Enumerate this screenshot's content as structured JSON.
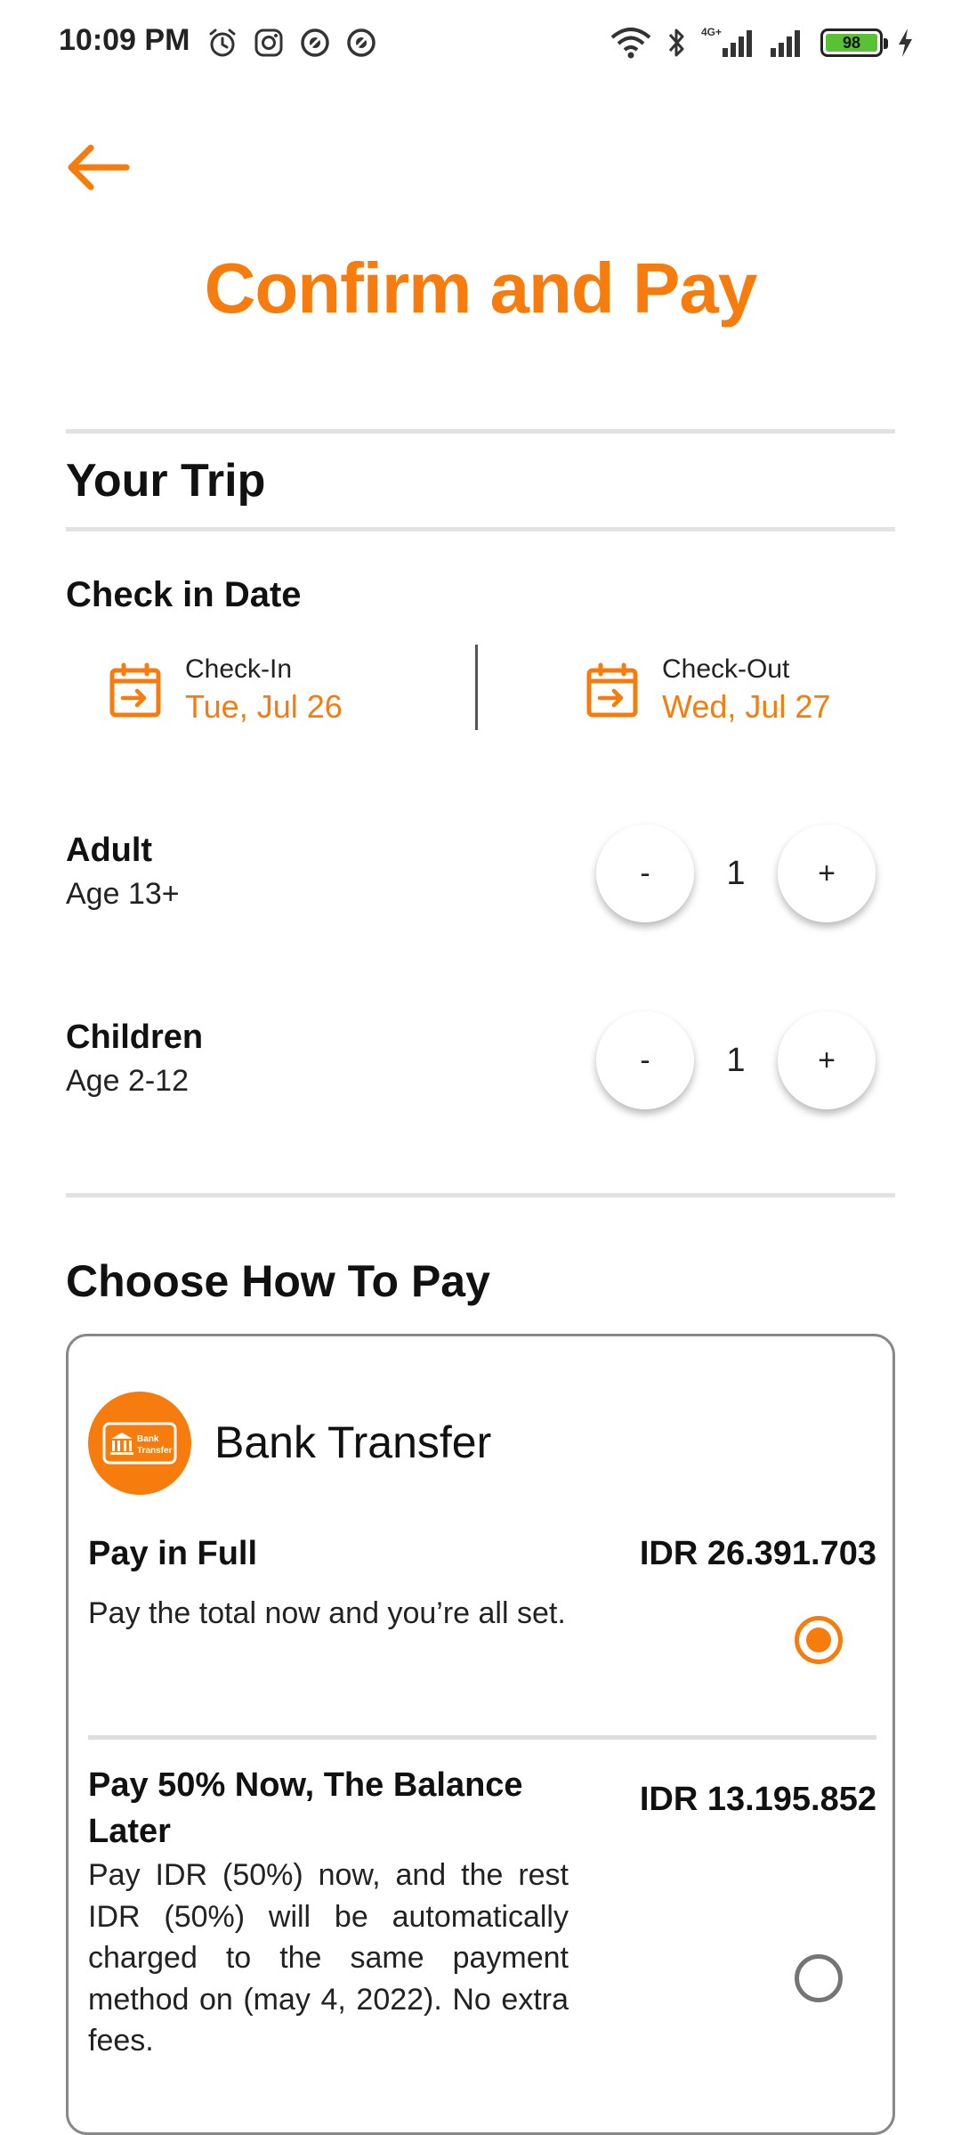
{
  "status_bar": {
    "time": "10:09 PM",
    "battery": "98",
    "left_icons": [
      "alarm-icon",
      "instagram-icon",
      "app-icon",
      "app-icon"
    ],
    "right_icons": [
      "wifi-icon",
      "bluetooth-icon",
      "signal-4g-icon",
      "signal-icon",
      "battery-icon",
      "charging-icon"
    ],
    "network_label": "4G+"
  },
  "header": {
    "title": "Confirm and Pay",
    "back_icon": "arrow-left-icon"
  },
  "trip": {
    "heading": "Your Trip",
    "date_heading": "Check in Date",
    "check_in": {
      "label": "Check-In",
      "value": "Tue, Jul 26"
    },
    "check_out": {
      "label": "Check-Out",
      "value": "Wed, Jul 27"
    }
  },
  "guests": {
    "adult": {
      "title": "Adult",
      "subtitle": "Age 13+",
      "count": "1"
    },
    "children": {
      "title": "Children",
      "subtitle": "Age 2-12",
      "count": "1"
    },
    "minus_label": "-",
    "plus_label": "+"
  },
  "payment": {
    "heading": "Choose How To Pay",
    "method": {
      "title": "Bank Transfer",
      "logo_text_line1": "Bank",
      "logo_text_line2": "Transfer"
    },
    "options": [
      {
        "title": "Pay in Full",
        "price": "IDR 26.391.703",
        "description": "Pay the total now and you’re all set.",
        "selected": true
      },
      {
        "title": "Pay 50% Now, The Balance Later",
        "price": "IDR 13.195.852",
        "description": "Pay IDR (50%) now, and the rest IDR (50%) will be automatically charged to the same payment method on (may 4, 2022). No extra fees.",
        "selected": false
      }
    ]
  },
  "colors": {
    "accent": "#f57c0d",
    "divider": "#e2e2e2",
    "battery": "#59c234"
  }
}
